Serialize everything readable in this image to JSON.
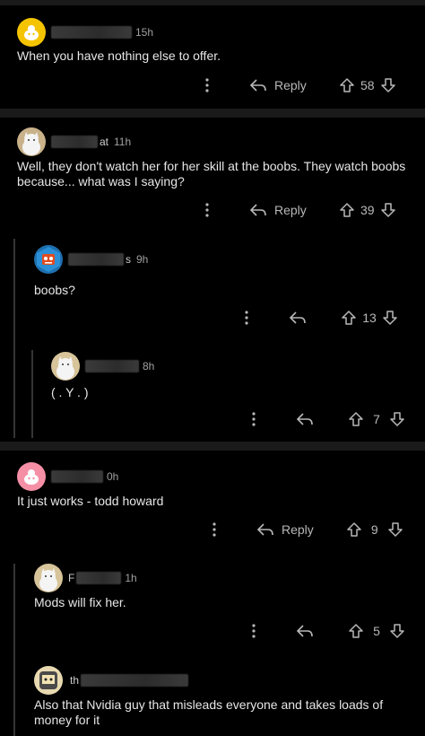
{
  "comments": [
    {
      "time": "15h",
      "body": "When you have nothing else to offer.",
      "reply_label": "Reply",
      "votes": "58",
      "avatar": "yellow-snoo-avatar"
    },
    {
      "time": "11h",
      "username_fragment": "at",
      "body": "Well, they don't watch her for her skill at the boobs. They watch boobs because... what was I saying?",
      "reply_label": "Reply",
      "votes": "39",
      "avatar": "white-cat-avatar"
    },
    {
      "time": "9h",
      "username_fragment": "s",
      "body": "boobs?",
      "votes": "13",
      "avatar": "robot-avatar"
    },
    {
      "time": "8h",
      "body": "( . Y . )",
      "votes": "7",
      "avatar": "white-cat-avatar"
    },
    {
      "time": "0h",
      "body": "It just works - todd howard",
      "reply_label": "Reply",
      "votes": "9",
      "avatar": "pink-snoo-avatar"
    },
    {
      "time": "1h",
      "username_fragment": "F",
      "body": "Mods will fix her.",
      "votes": "5",
      "avatar": "white-cat-avatar"
    },
    {
      "username_fragment": "th",
      "body": "Also that Nvidia guy that misleads everyone and takes loads of money for it",
      "avatar": "cartoon-avatar"
    }
  ],
  "colors": {
    "background": "#000000",
    "separator": "#1a1a1b",
    "thread_line": "#343536",
    "text": "#e6e6e6",
    "meta": "#a0a0a0"
  }
}
